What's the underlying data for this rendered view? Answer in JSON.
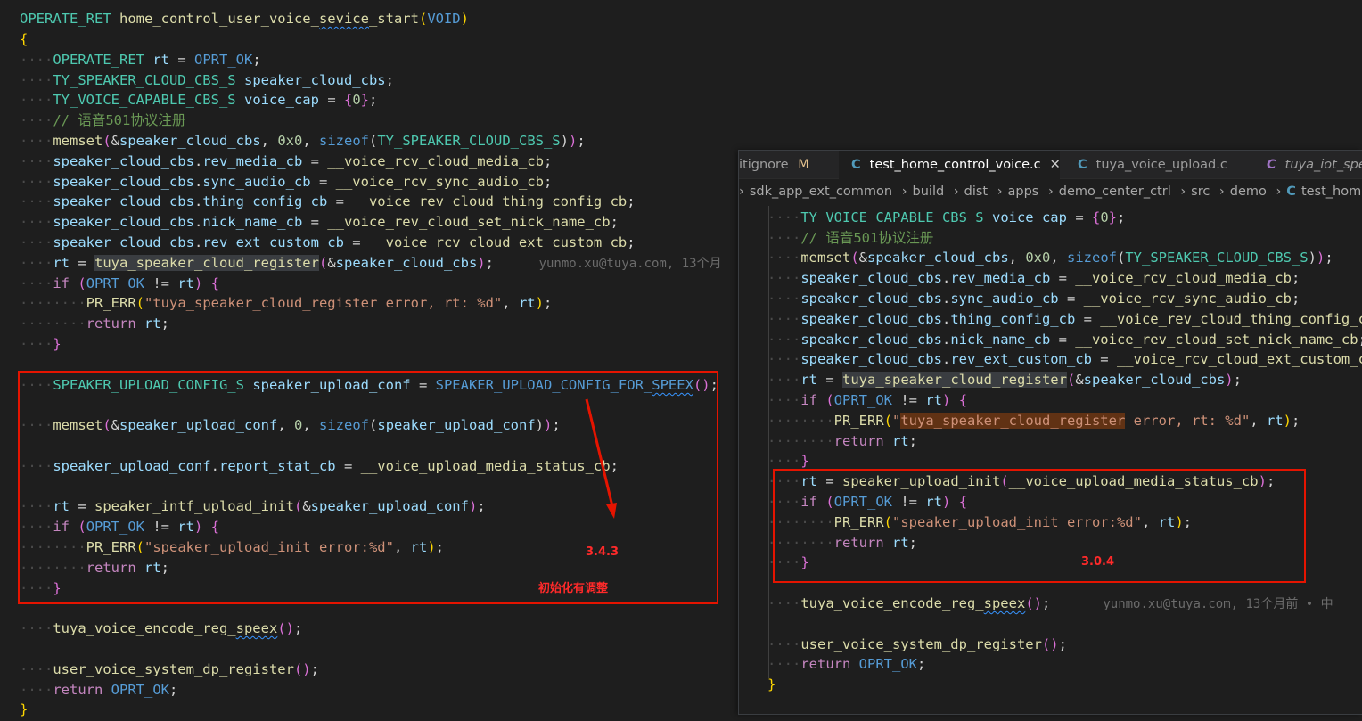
{
  "left_code": {
    "signature_ret": "OPERATE_RET",
    "signature_fn": "home_control_user_voice_",
    "signature_fn_squig": "sevice",
    "signature_fn_tail": "_start",
    "signature_void": "VOID",
    "comment_cn": "// 语音501协议注册",
    "blame": "yunmo.xu@tuya.com, 13个月",
    "fn_upload_config_macro": "SPEAKER_UPLOAD_CONFIG_FOR_",
    "speex": "SPEEX",
    "err_register": "\"tuya_speaker_cloud_register error, rt: %d\"",
    "err_upload_init": "\"speaker_upload_init error:%d\""
  },
  "annotations": {
    "left_version": "3.4.3",
    "left_note": "初始化有调整",
    "right_version": "3.0.4"
  },
  "right_window": {
    "tabs": [
      {
        "label": "itignore",
        "badge": "M"
      },
      {
        "label": "test_home_control_voice.c",
        "close": "✕"
      },
      {
        "label": "tuya_voice_upload.c"
      },
      {
        "label": "tuya_iot_spea"
      }
    ],
    "breadcrumb": [
      "sdk_app_ext_common",
      "build",
      "dist",
      "apps",
      "demo_center_ctrl",
      "src",
      "demo",
      "test_home_cont"
    ],
    "blame": "yunmo.xu@tuya.com, 13个月前 • 中"
  }
}
